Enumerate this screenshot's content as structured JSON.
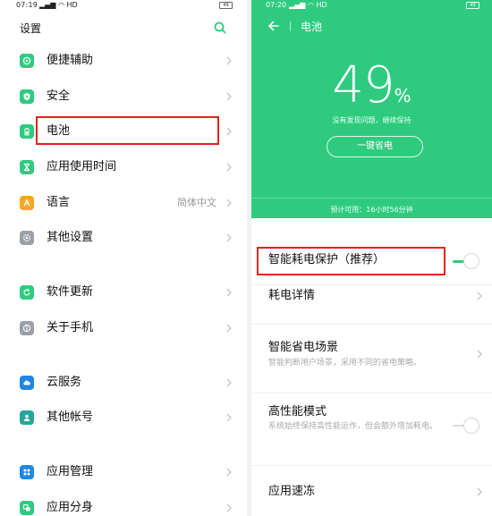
{
  "left": {
    "status_time": "07:19",
    "status_icons": "▂▄▆ ◠ HD",
    "battery": "49",
    "title": "设置",
    "items": [
      {
        "label": "便捷辅助",
        "icon": "accessibility-icon",
        "color": "#2ecb7f"
      },
      {
        "label": "安全",
        "icon": "shield-icon",
        "color": "#2ecb7f"
      },
      {
        "label": "电池",
        "icon": "battery-icon",
        "color": "#2ecb7f"
      },
      {
        "label": "应用使用时间",
        "icon": "hourglass-icon",
        "color": "#2ecb7f"
      },
      {
        "label": "语言",
        "icon": "language-icon",
        "color": "#f5a623",
        "value": "简体中文"
      },
      {
        "label": "其他设置",
        "icon": "gear-icon",
        "color": "#9aa0a6"
      },
      {
        "label": "软件更新",
        "icon": "update-icon",
        "color": "#2ecb7f"
      },
      {
        "label": "关于手机",
        "icon": "info-icon",
        "color": "#9aa0a6"
      },
      {
        "label": "云服务",
        "icon": "cloud-icon",
        "color": "#1e88e5"
      },
      {
        "label": "其他帐号",
        "icon": "account-icon",
        "color": "#26a69a"
      },
      {
        "label": "应用管理",
        "icon": "apps-icon",
        "color": "#1e88e5"
      },
      {
        "label": "应用分身",
        "icon": "clone-icon",
        "color": "#2ecb7f"
      }
    ]
  },
  "right": {
    "status_time": "07:20",
    "status_icons": "▂▄▆ ◠ HD",
    "battery": "49",
    "title": "电池",
    "battery_level": "49",
    "battery_unit": "%",
    "status_text": "没有发现问题，继续保持",
    "save_button": "一键省电",
    "estimate": "预计可用：16小时56分钟",
    "rows": [
      {
        "title": "智能耗电保护（推荐）",
        "control": "toggle",
        "on": true
      },
      {
        "title": "耗电详情",
        "control": "chevron"
      },
      {
        "title": "智能省电场景",
        "subtitle": "智能判断用户场景，采用不同的省电策略。",
        "control": "chevron"
      },
      {
        "title": "高性能模式",
        "subtitle": "系统始终保持高性能运作，但会额外增加耗电。",
        "control": "toggle",
        "on": false
      },
      {
        "title": "应用速冻",
        "control": "chevron"
      }
    ]
  },
  "colors": {
    "accent": "#2ecb7f",
    "highlight": "#e0231e"
  }
}
